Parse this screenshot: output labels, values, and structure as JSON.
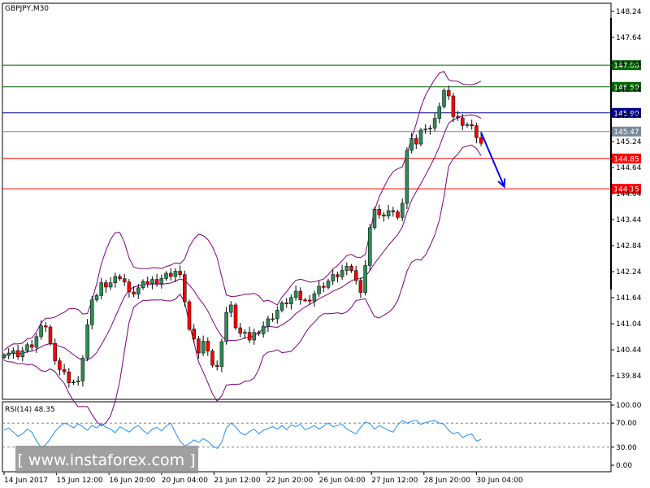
{
  "chart_data": {
    "type": "candlestick",
    "title": "GBPJPY,M30",
    "price_axis": {
      "ticks": [
        "148.24",
        "147.64",
        "147.04",
        "146.44",
        "145.84",
        "145.24",
        "144.64",
        "144.04",
        "143.44",
        "142.84",
        "142.24",
        "141.64",
        "141.04",
        "140.44",
        "139.84"
      ],
      "ylim": [
        139.5,
        148.5
      ]
    },
    "time_axis": {
      "labels": [
        "14 Jun 2017",
        "15 Jun 12:00",
        "16 Jun 20:00",
        "20 Jun 04:00",
        "21 Jun 12:00",
        "22 Jun 20:00",
        "26 Jun 04:00",
        "27 Jun 12:00",
        "28 Jun 20:00",
        "30 Jun 04:00"
      ]
    },
    "levels": [
      {
        "label": "147.00",
        "value": 147.0,
        "color": "#006400"
      },
      {
        "label": "146.50",
        "value": 146.5,
        "color": "#006400"
      },
      {
        "label": "145.90",
        "value": 145.9,
        "color": "#00008b"
      },
      {
        "label": "145.47",
        "value": 145.47,
        "color": "#778899"
      },
      {
        "label": "144.85",
        "value": 144.85,
        "color": "#ff0000"
      },
      {
        "label": "144.15",
        "value": 144.15,
        "color": "#ff0000"
      }
    ],
    "price_path": [
      [
        0,
        140.4
      ],
      [
        3,
        140.35
      ],
      [
        6,
        140.55
      ],
      [
        8,
        140.9
      ],
      [
        9,
        141.0
      ],
      [
        10,
        140.55
      ],
      [
        12,
        140.0
      ],
      [
        14,
        139.75
      ],
      [
        16,
        139.65
      ],
      [
        17,
        140.3
      ],
      [
        18,
        141.0
      ],
      [
        19,
        141.5
      ],
      [
        21,
        141.95
      ],
      [
        23,
        142.0
      ],
      [
        25,
        142.15
      ],
      [
        26,
        142.0
      ],
      [
        27,
        141.7
      ],
      [
        29,
        141.85
      ],
      [
        31,
        142.0
      ],
      [
        33,
        142.05
      ],
      [
        35,
        142.15
      ],
      [
        37,
        142.25
      ],
      [
        38,
        142.1
      ],
      [
        39,
        141.6
      ],
      [
        40,
        140.9
      ],
      [
        41,
        140.6
      ],
      [
        42,
        140.4
      ],
      [
        43,
        140.6
      ],
      [
        44,
        140.5
      ],
      [
        45,
        140.1
      ],
      [
        46,
        140.0
      ],
      [
        47,
        140.7
      ],
      [
        48,
        141.3
      ],
      [
        49,
        141.4
      ],
      [
        50,
        141.0
      ],
      [
        51,
        140.8
      ],
      [
        53,
        140.7
      ],
      [
        55,
        140.9
      ],
      [
        57,
        141.1
      ],
      [
        59,
        141.35
      ],
      [
        61,
        141.55
      ],
      [
        63,
        141.7
      ],
      [
        65,
        141.55
      ],
      [
        67,
        141.75
      ],
      [
        69,
        141.95
      ],
      [
        71,
        142.1
      ],
      [
        73,
        142.25
      ],
      [
        75,
        142.3
      ],
      [
        76,
        142.0
      ],
      [
        77,
        141.85
      ],
      [
        78,
        142.4
      ],
      [
        79,
        143.2
      ],
      [
        80,
        143.75
      ],
      [
        81,
        143.55
      ],
      [
        82,
        143.45
      ],
      [
        83,
        143.7
      ],
      [
        84,
        143.6
      ],
      [
        85,
        143.4
      ],
      [
        86,
        143.85
      ],
      [
        87,
        145.0
      ],
      [
        88,
        145.4
      ],
      [
        89,
        145.2
      ],
      [
        90,
        145.45
      ],
      [
        91,
        145.6
      ],
      [
        92,
        145.55
      ],
      [
        93,
        145.7
      ],
      [
        94,
        146.1
      ],
      [
        95,
        146.4
      ],
      [
        96,
        146.2
      ],
      [
        97,
        145.85
      ],
      [
        98,
        145.75
      ],
      [
        99,
        145.7
      ],
      [
        100,
        145.65
      ],
      [
        101,
        145.55
      ],
      [
        102,
        145.4
      ],
      [
        103,
        145.2
      ]
    ],
    "forecast_arrow": {
      "from": [
        103,
        145.45
      ],
      "to": [
        108,
        144.2
      ],
      "color": "#0000ff"
    },
    "indicator": {
      "label": "RSI(14) 48.35",
      "ticks": [
        "100.00",
        "70.00",
        "30.00",
        "0.00"
      ],
      "levels": [
        70,
        30
      ],
      "ylim": [
        0,
        100
      ],
      "values": [
        58,
        62,
        55,
        48,
        52,
        60,
        55,
        40,
        30,
        34,
        44,
        56,
        64,
        70,
        67,
        62,
        69,
        64,
        58,
        66,
        62,
        69,
        63,
        60,
        54,
        64,
        60,
        55,
        62,
        66,
        58,
        52,
        60,
        63,
        57,
        65,
        70,
        54,
        40,
        32,
        36,
        42,
        38,
        44,
        40,
        32,
        28,
        38,
        62,
        70,
        64,
        54,
        50,
        56,
        60,
        52,
        58,
        61,
        64,
        60,
        66,
        59,
        67,
        64,
        68,
        59,
        62,
        66,
        60,
        65,
        70,
        64,
        66,
        68,
        60,
        56,
        52,
        63,
        72,
        69,
        60,
        66,
        62,
        58,
        55,
        67,
        74,
        70,
        73,
        75,
        68,
        71,
        73,
        74,
        70,
        68,
        58,
        52,
        55,
        46,
        50,
        52,
        40,
        43
      ]
    },
    "watermark": "[  www.instaforex.com  ]"
  }
}
